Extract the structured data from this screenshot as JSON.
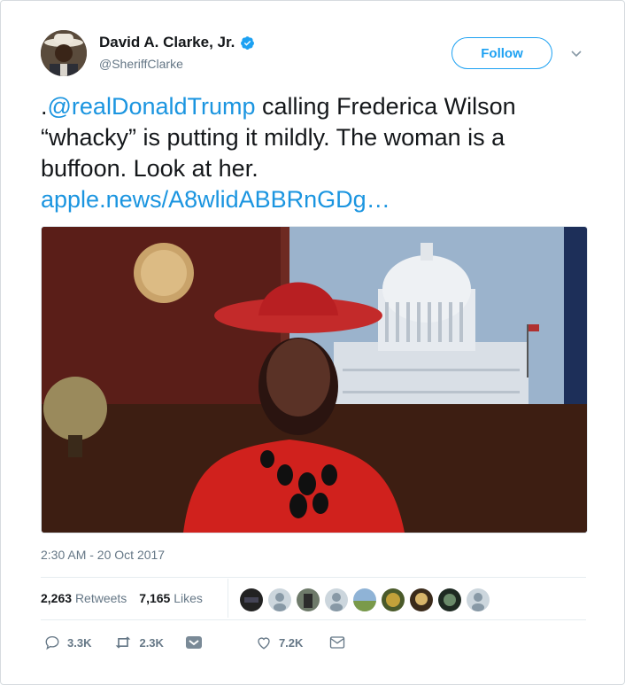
{
  "author": {
    "name": "David A. Clarke, Jr.",
    "handle": "@SheriffClarke",
    "verified_icon": "verified-badge-icon"
  },
  "follow_button": {
    "label": "Follow"
  },
  "tweet": {
    "prefix": ".",
    "mention": "@realDonaldTrump",
    "body": " calling Frederica Wilson “whacky” is putting it mildly. The woman is a buffoon. Look at her.",
    "link": "apple.news/A8wlidABBRnGDg…"
  },
  "timestamp": "2:30 AM - 20 Oct 2017",
  "stats": {
    "retweets_count": "2,263",
    "retweets_label": "Retweets",
    "likes_count": "7,165",
    "likes_label": "Likes"
  },
  "actions": {
    "replies": "3.3K",
    "retweets": "2.3K",
    "likes": "7.2K"
  },
  "colors": {
    "accent": "#1da1f2",
    "link": "#1b95e0",
    "text": "#14171a",
    "muted": "#657786"
  }
}
